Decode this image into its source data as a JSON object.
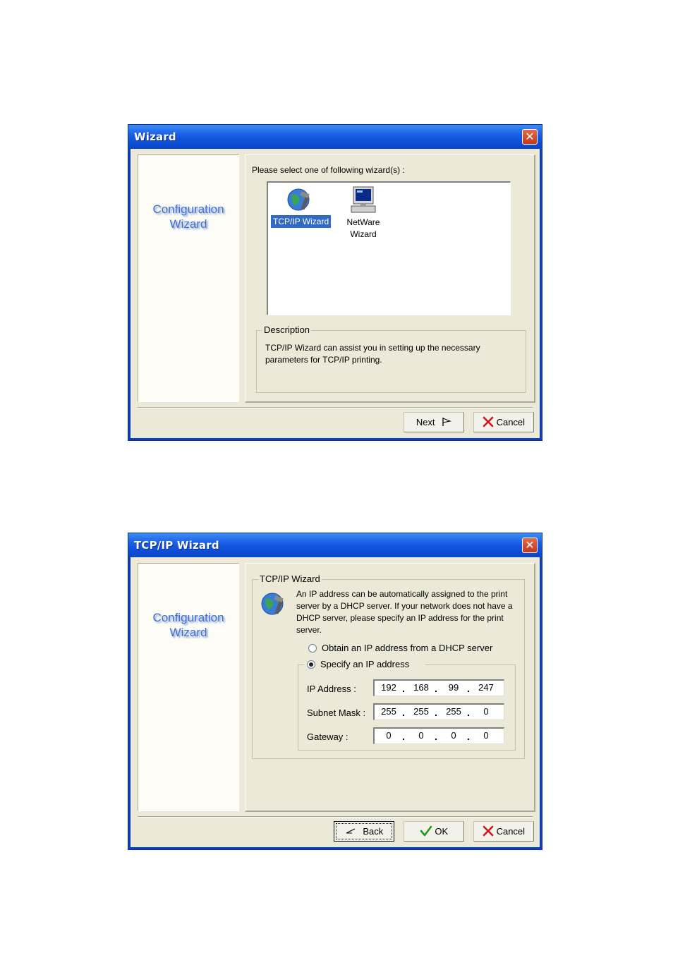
{
  "wizard_dialog": {
    "title": "Wizard",
    "close_glyph": "✕",
    "side_logo_line1": "Configuration",
    "side_logo_line2": "Wizard",
    "prompt": "Please select one of following wizard(s) :",
    "wizards": [
      {
        "label": "TCP/IP Wizard",
        "icon": "globe-tools-icon",
        "selected": true
      },
      {
        "label_line1": "NetWare",
        "label_line2": "Wizard",
        "icon": "computer-icon",
        "selected": false
      }
    ],
    "description_label": "Description",
    "description_text": "TCP/IP Wizard can assist you in setting up the necessary parameters for TCP/IP printing.",
    "next_label": "Next",
    "cancel_label": "Cancel"
  },
  "tcpip_dialog": {
    "title": "TCP/IP Wizard",
    "close_glyph": "✕",
    "side_logo_line1": "Configuration",
    "side_logo_line2": "Wizard",
    "group_label": "TCP/IP Wizard",
    "intro": "An IP address can be automatically assigned to the print server by a DHCP server. If your network does not have a DHCP server, please specify an IP address for the print server.",
    "option_dhcp": "Obtain an IP address from a DHCP server",
    "option_specify": "Specify an IP address",
    "selected_option": "specify",
    "ip_address_label": "IP Address :",
    "ip_address": [
      "192",
      "168",
      "99",
      "247"
    ],
    "subnet_mask_label": "Subnet Mask :",
    "subnet_mask": [
      "255",
      "255",
      "255",
      "0"
    ],
    "gateway_label": "Gateway :",
    "gateway": [
      "0",
      "0",
      "0",
      "0"
    ],
    "back_label": "Back",
    "ok_label": "OK",
    "cancel_label": "Cancel"
  },
  "colors": {
    "title_bar": "#0a45c6",
    "dialog_face": "#ece9d8",
    "selection": "#316ac5",
    "close_button": "#c4381d",
    "logo_text": "#3c6fd6"
  }
}
